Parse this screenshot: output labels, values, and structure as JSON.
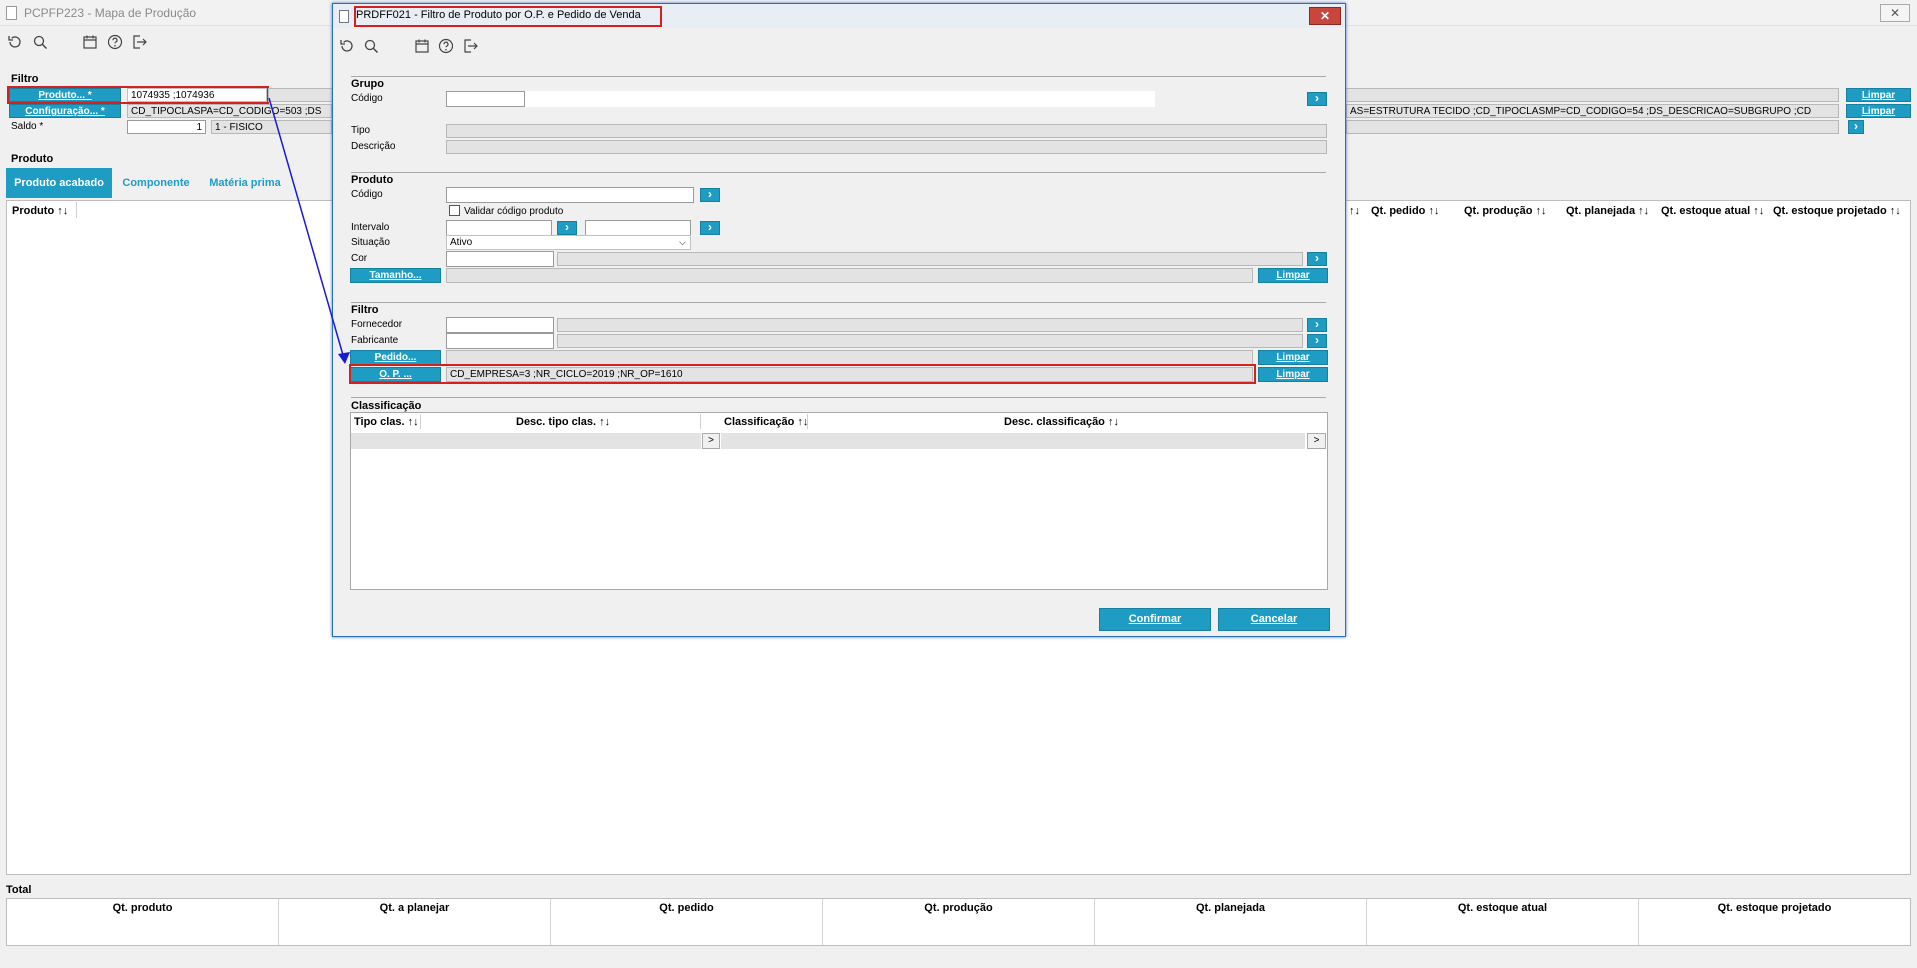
{
  "main": {
    "window_title": "PCPFP223 - Mapa de Produção",
    "close_glyph": "✕",
    "filtro_title": "Filtro",
    "produto_button": "Produto... *",
    "produto_value": "1074935 ;1074936",
    "configuracao_button": "Configuração... *",
    "configuracao_value": "CD_TIPOCLASPA=CD_CODIGO=503 ;DS",
    "configuracao_value_right": "AS=ESTRUTURA TECIDO ;CD_TIPOCLASMP=CD_CODIGO=54 ;DS_DESCRICAO=SUBGRUPO ;CD",
    "saldo_label": "Saldo *",
    "saldo_value": "1",
    "saldo_select": "1 - FISICO",
    "limpar_1": "Limpar",
    "limpar_2": "Limpar",
    "produto_section": "Produto",
    "tabs": [
      {
        "label": "Produto acabado"
      },
      {
        "label": "Componente"
      },
      {
        "label": "Matéria prima"
      }
    ],
    "grid_headers_left": "Produto ↑↓",
    "grid_headers_right": [
      "↑↓",
      "Qt. pedido ↑↓",
      "Qt. produção ↑↓",
      "Qt. planejada ↑↓",
      "Qt. estoque atual ↑↓",
      "Qt. estoque projetado ↑↓"
    ],
    "total_title": "Total",
    "total_columns": [
      "Qt. produto",
      "Qt. a planejar",
      "Qt. pedido",
      "Qt. produção",
      "Qt. planejada",
      "Qt. estoque atual",
      "Qt. estoque projetado"
    ]
  },
  "dialog": {
    "title": "PRDFF021 - Filtro de Produto por O.P. e Pedido de Venda",
    "close_glyph": "✕",
    "grupo_title": "Grupo",
    "grupo_codigo_label": "Código",
    "grupo_tipo_label": "Tipo",
    "grupo_descricao_label": "Descrição",
    "produto_title": "Produto",
    "produto_codigo_label": "Código",
    "validar_label": "Validar código produto",
    "intervalo_label": "Intervalo",
    "situacao_label": "Situação",
    "situacao_value": "Ativo",
    "cor_label": "Cor",
    "tamanho_button": "Tamanho...",
    "limpar_tamanho": "Limpar",
    "filtro_title": "Filtro",
    "fornecedor_label": "Fornecedor",
    "fabricante_label": "Fabricante",
    "pedido_button": "Pedido...",
    "limpar_pedido": "Limpar",
    "op_button": "O. P. ...",
    "op_value": "CD_EMPRESA=3 ;NR_CICLO=2019 ;NR_OP=1610",
    "limpar_op": "Limpar",
    "classificacao_title": "Classificação",
    "class_headers": [
      "Tipo clas. ↑↓",
      "Desc. tipo clas. ↑↓",
      "Classificação ↑↓",
      "Desc. classificação ↑↓"
    ],
    "scroll_glyph": ">",
    "confirmar": "Confirmar",
    "cancelar": "Cancelar"
  },
  "colors": {
    "accent": "#1f9cc4",
    "highlight": "#d42020",
    "arrow": "#1a1ad6"
  }
}
